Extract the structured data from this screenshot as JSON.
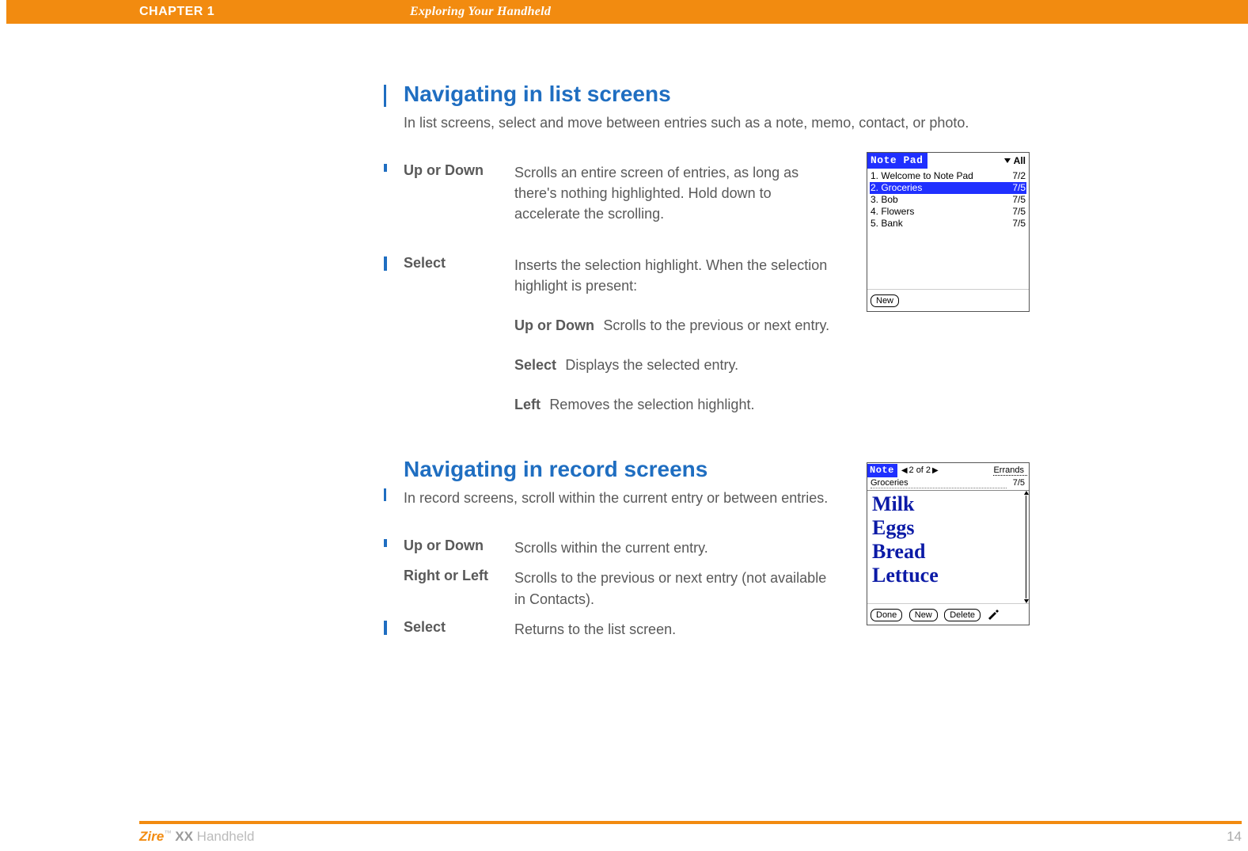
{
  "header": {
    "chapter": "CHAPTER 1",
    "title": "Exploring Your Handheld"
  },
  "section_list": {
    "heading": "Navigating in list screens",
    "intro": "In list screens, select and move between entries such as a note, memo, contact, or photo.",
    "items": [
      {
        "term": "Up or Down",
        "desc": "Scrolls an entire screen of entries, as long as there's nothing highlighted. Hold down to accelerate the scrolling."
      },
      {
        "term": "Select",
        "desc": "Inserts the selection highlight. When the selection highlight is present:",
        "sub": [
          {
            "term": "Up or Down",
            "desc": "Scrolls to the previous or next entry."
          },
          {
            "term": "Select",
            "desc": "Displays the selected entry."
          },
          {
            "term": "Left",
            "desc": "Removes the selection highlight."
          }
        ]
      }
    ]
  },
  "section_record": {
    "heading": "Navigating in record screens",
    "intro": "In record screens, scroll within the current entry or between entries.",
    "items": [
      {
        "term": "Up or Down",
        "desc": "Scrolls within the current entry."
      },
      {
        "term": "Right or Left",
        "desc": "Scrolls to the previous or next entry (not available in Contacts)."
      },
      {
        "term": "Select",
        "desc": "Returns to the list screen."
      }
    ]
  },
  "fig_list": {
    "title": "Note Pad",
    "category": "All",
    "rows": [
      {
        "n": "1.",
        "name": "Welcome to Note Pad",
        "date": "7/2",
        "selected": false
      },
      {
        "n": "2.",
        "name": "Groceries",
        "date": "7/5",
        "selected": true
      },
      {
        "n": "3.",
        "name": "Bob",
        "date": "7/5",
        "selected": false
      },
      {
        "n": "4.",
        "name": "Flowers",
        "date": "7/5",
        "selected": false
      },
      {
        "n": "5.",
        "name": "Bank",
        "date": "7/5",
        "selected": false
      }
    ],
    "new_btn": "New"
  },
  "fig_note": {
    "title": "Note",
    "page": "2 of 2",
    "category": "Errands",
    "entry": "Groceries",
    "date": "7/5",
    "lines": [
      "Milk",
      "Eggs",
      "Bread",
      "Lettuce"
    ],
    "done_btn": "Done",
    "new_btn": "New",
    "delete_btn": "Delete"
  },
  "footer": {
    "brand_html_parts": {
      "z": "Zire",
      "tm": "™",
      "xx": " XX",
      "rest": " Handheld"
    },
    "page": "14"
  }
}
